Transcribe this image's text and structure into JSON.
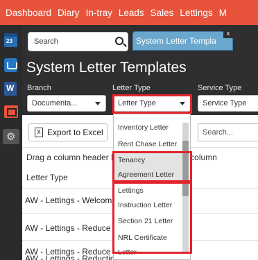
{
  "nav": {
    "items": [
      "Dashboard",
      "Diary",
      "In-tray",
      "Leads",
      "Sales",
      "Lettings",
      "M"
    ]
  },
  "leftbar": {
    "calendar_day": "23"
  },
  "search": {
    "placeholder": "Search"
  },
  "tab": {
    "label": "System Letter Templa",
    "close": "x"
  },
  "page": {
    "title": "System Letter Templates"
  },
  "filters": {
    "branch": {
      "label": "Branch",
      "value": "Documenta..."
    },
    "letter_type": {
      "label": "Letter Type",
      "value": "Letter Type"
    },
    "service_type": {
      "label": "Service Type",
      "value": "Service Type"
    }
  },
  "grid": {
    "export_label": "Export to Excel",
    "excel_icon": "X",
    "search_placeholder": "Search...",
    "group_hint": "Drag a column header here to group by that column",
    "column_header": "Letter Type",
    "rows": [
      "AW - Lettings - Welcome",
      "AW - Lettings - Reduce",
      "AW - Lettings - Reduce",
      "AW - Lettings - Reduction Soon"
    ]
  },
  "dropdown": {
    "options": [
      "Inventory Letter",
      "Rent Chase Letter",
      "Tenancy",
      "Agreement Letter",
      "Lettings",
      "Instruction Letter",
      "Section 21 Letter",
      "NRL Certificate",
      "Letter"
    ]
  },
  "colors": {
    "nav_bg": "#e8543b",
    "tab_bg": "#69a7cc",
    "highlight_box": "#e3232b",
    "app_bg": "#2f2f31"
  }
}
